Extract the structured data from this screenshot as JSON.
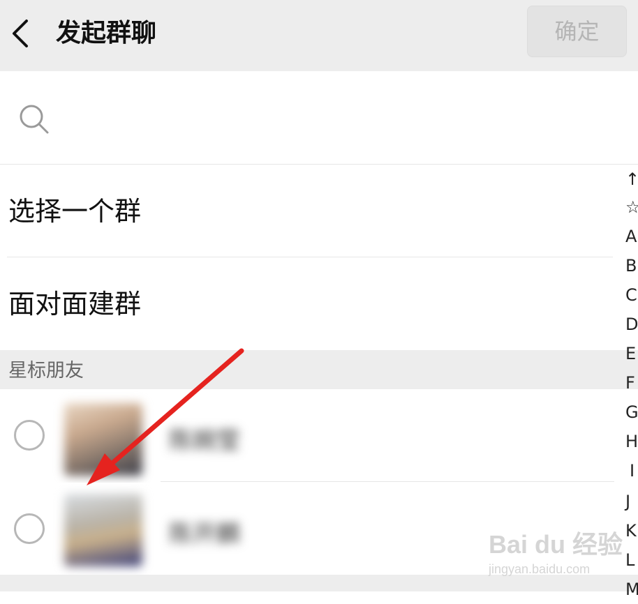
{
  "header": {
    "title": "发起群聊",
    "confirm_label": "确定"
  },
  "search": {
    "placeholder": ""
  },
  "menu": {
    "items": [
      {
        "label": "选择一个群"
      },
      {
        "label": "面对面建群"
      }
    ]
  },
  "section": {
    "starred_header": "星标朋友"
  },
  "contacts": [
    {
      "name": "陈婉莹"
    },
    {
      "name": "陈开麟"
    }
  ],
  "index_bar": {
    "letters": [
      "↑",
      "☆",
      "A",
      "B",
      "C",
      "D",
      "E",
      "F",
      "G",
      "H",
      "I",
      "J",
      "K",
      "L",
      "M"
    ]
  },
  "watermark": {
    "brand": "Bai du 经验",
    "url": "jingyan.baidu.com"
  },
  "colors": {
    "annotation_arrow": "#e5231f",
    "top_bar": "#ededed",
    "confirm_disabled": "#b5b5b5"
  },
  "icons": [
    "back-icon",
    "search-icon"
  ]
}
